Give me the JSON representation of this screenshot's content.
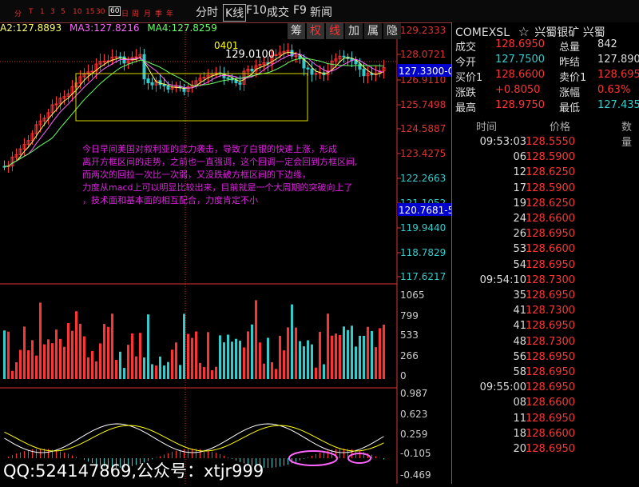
{
  "toolbar": {
    "periods": [
      "分",
      "T",
      "1",
      "3",
      "5",
      "10",
      "15",
      "30",
      "60",
      "日",
      "周",
      "月",
      "季",
      "年"
    ],
    "selected_period": "60",
    "buttons": [
      "分时",
      "K线",
      "F10",
      "成交",
      "F9",
      "新闻"
    ],
    "selected_button": "K线"
  },
  "ma_legend": {
    "ma2": "A2:127.8893",
    "ma3": "MA3:127.8216",
    "ma4": "MA4:127.8259"
  },
  "tags": [
    "筹",
    "权",
    "线",
    "加",
    "属",
    "隐"
  ],
  "price_axis": [
    "129.2333",
    "128.0721",
    "126.9110",
    "125.7498",
    "124.5887",
    "123.4275",
    "122.2663",
    "121.1052",
    "119.9440",
    "118.7829",
    "117.6217"
  ],
  "price_axis_colors": {
    "up": "#dd3333",
    "down": "#33cccc"
  },
  "current_price_flag": "127.3300-0",
  "lower_price_flag": "120.7681-5",
  "chart_labels": {
    "peak_time": "0401",
    "peak_price": "129.0100"
  },
  "volume_axis": [
    "1065",
    "799",
    "533",
    "266",
    "0"
  ],
  "macd_axis": [
    "0.987",
    "0.623",
    "0.259",
    "-0.105",
    "-0.469"
  ],
  "annotation": [
    "今日早间美国对叙利亚的武力袭击，导致了白银的快速上涨，形成",
    "离开方框区间的走势，之前也一直强调，这个回调一定会回到方框区间,",
    "而两次的回拉一次比一次弱，又没跌破方框区间的下边缘，",
    "力度从macd上可以明显比较出来，目前就是一个大周期的突破向上了",
    "，技术面和基本面的相互配合，力度肯定不小"
  ],
  "watermark": "QQ:524147869,公众号：xtjr999",
  "panel": {
    "symbol": "COMEXSL",
    "star": "☆",
    "name": "兴蜀银矿 兴蜀",
    "quotes": [
      {
        "l1": "成交",
        "v1": "128.6950",
        "c1": "#ff3333",
        "l2": "总量",
        "v2": "842",
        "c2": "#dddddd"
      },
      {
        "l1": "今开",
        "v1": "127.7500",
        "c1": "#33cccc",
        "l2": "昨结",
        "v2": "127.8900",
        "c2": "#dddddd"
      },
      {
        "l1": "买价1",
        "v1": "128.6600",
        "c1": "#ff3333",
        "l2": "卖价1",
        "v2": "128.6950",
        "c2": "#ff3333"
      },
      {
        "l1": "涨跌",
        "v1": "+0.8050",
        "c1": "#ff3333",
        "l2": "涨幅",
        "v2": "0.63%",
        "c2": "#ff3333"
      },
      {
        "l1": "最高",
        "v1": "128.9750",
        "c1": "#ff3333",
        "l2": "最低",
        "v2": "127.4350",
        "c2": "#33cccc"
      }
    ],
    "trade_headers": [
      "时间",
      "价格",
      "数量"
    ],
    "trades": [
      {
        "time": "09:53:03",
        "price": "128.5550"
      },
      {
        "time": "06",
        "price": "128.5900"
      },
      {
        "time": "12",
        "price": "128.6250"
      },
      {
        "time": "17",
        "price": "128.5900"
      },
      {
        "time": "19",
        "price": "128.6250"
      },
      {
        "time": "24",
        "price": "128.6600"
      },
      {
        "time": "26",
        "price": "128.6950"
      },
      {
        "time": "53",
        "price": "128.6600"
      },
      {
        "time": "54",
        "price": "128.6950"
      },
      {
        "time": "09:54:10",
        "price": "128.7300"
      },
      {
        "time": "35",
        "price": "128.6950"
      },
      {
        "time": "41",
        "price": "128.7300"
      },
      {
        "time": "41",
        "price": "128.6950"
      },
      {
        "time": "48",
        "price": "128.7300"
      },
      {
        "time": "56",
        "price": "128.6950"
      },
      {
        "time": "58",
        "price": "128.6950"
      },
      {
        "time": "09:55:00",
        "price": "128.6950"
      },
      {
        "time": "08",
        "price": "128.6600"
      },
      {
        "time": "11",
        "price": "128.6950"
      },
      {
        "time": "18",
        "price": "128.6600"
      },
      {
        "time": "20",
        "price": "128.6950"
      }
    ]
  }
}
